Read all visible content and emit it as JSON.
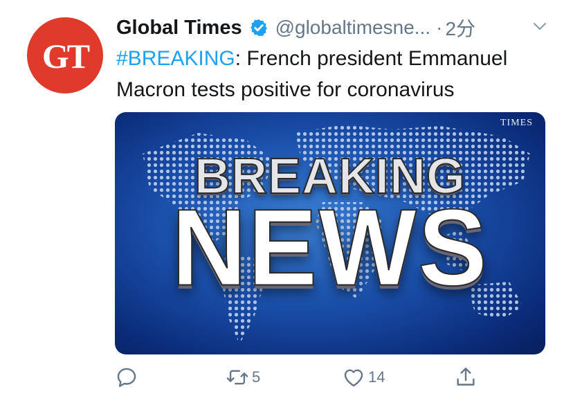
{
  "account": {
    "avatar_text": "GT",
    "name": "Global Times",
    "handle": "@globaltimesne...",
    "separator": "·",
    "time": "2分",
    "verified_icon": "verified-badge-icon",
    "menu_icon": "chevron-down-icon"
  },
  "tweet": {
    "hashtag": "#BREAKING",
    "text_rest": ": French president Emmanuel Macron tests positive for coronavirus"
  },
  "media": {
    "watermark": "TIMES",
    "headline_top": "BREAKING",
    "headline_bottom": "NEWS"
  },
  "actions": {
    "reply": {
      "icon": "reply-icon",
      "count": ""
    },
    "retweet": {
      "icon": "retweet-icon",
      "count": "5"
    },
    "like": {
      "icon": "heart-icon",
      "count": "14"
    },
    "share": {
      "icon": "share-icon",
      "count": ""
    }
  },
  "colors": {
    "accent": "#1da1f2",
    "secondary_text": "#657786",
    "avatar_bg": "#e03a2c"
  }
}
